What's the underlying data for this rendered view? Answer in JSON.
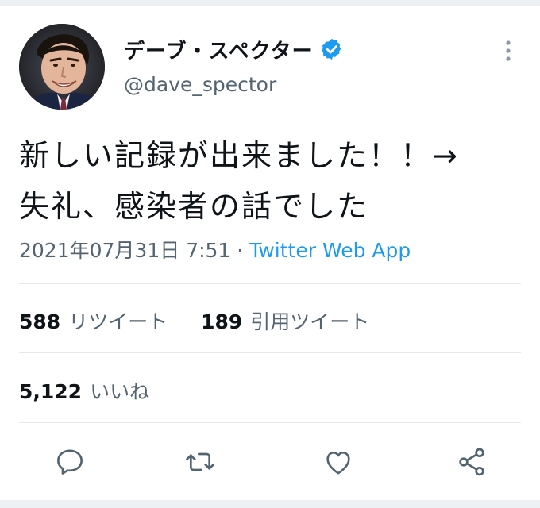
{
  "user": {
    "display_name": "デーブ・スペクター",
    "handle": "@dave_spector"
  },
  "tweet": {
    "text_line1": "新しい記録が出来ました！！→",
    "text_line2": "失礼、感染者の話でした",
    "timestamp": "2021年07月31日 7:51",
    "separator": "·",
    "source": "Twitter Web App"
  },
  "stats": {
    "retweets_count": "588",
    "retweets_label": "リツイート",
    "quotes_count": "189",
    "quotes_label": "引用ツイート",
    "likes_count": "5,122",
    "likes_label": "いいね"
  },
  "icons": {
    "verified": "verified-badge-icon",
    "more": "more-vertical-icon",
    "reply": "reply-icon",
    "retweet": "retweet-icon",
    "like": "like-icon",
    "share": "share-icon"
  },
  "colors": {
    "verified_blue": "#1d9bf0",
    "link_blue": "#1d9bf0",
    "muted_text": "#536471",
    "primary_text": "#0f1419"
  }
}
